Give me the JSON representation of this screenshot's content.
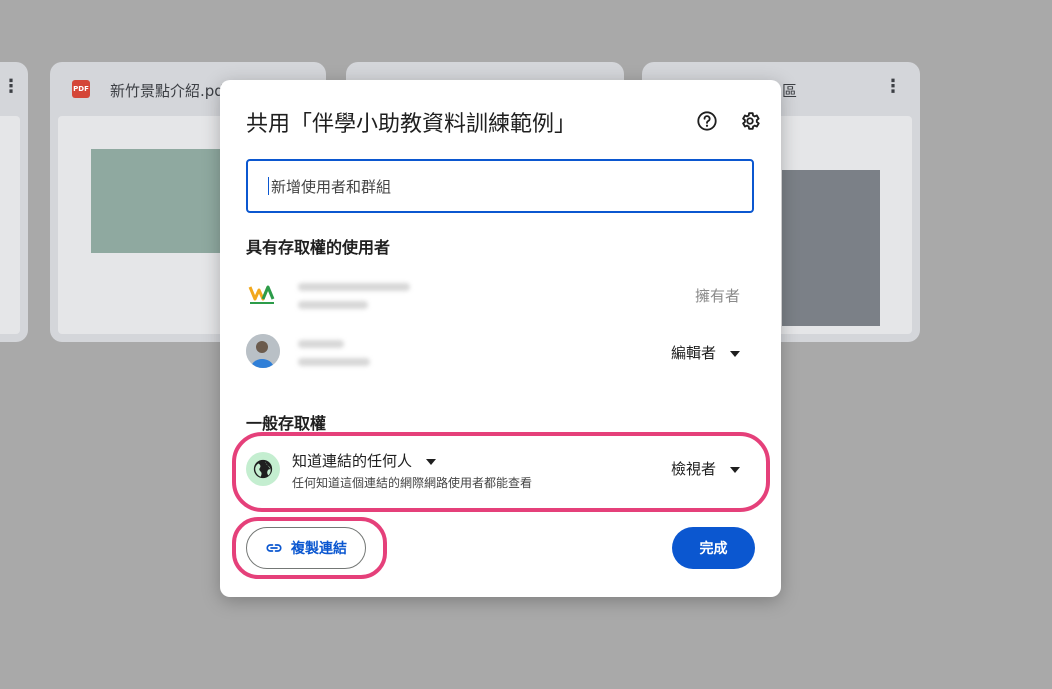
{
  "background": {
    "cards": [
      {
        "title": "",
        "icon": "pdf"
      },
      {
        "title": "新竹景點介紹.pd",
        "icon": "pdf",
        "badge": "PDF"
      },
      {
        "title": "",
        "icon": "none"
      },
      {
        "title": "區",
        "icon": "none"
      }
    ]
  },
  "dialog": {
    "title": "共用「伴學小助教資料訓練範例」",
    "help_icon": "help-circle-icon",
    "settings_icon": "gear-icon",
    "search": {
      "placeholder": "新增使用者和群組"
    },
    "people_section": "具有存取權的使用者",
    "people": [
      {
        "role": "擁有者",
        "avatar": "wesduno-logo"
      },
      {
        "role": "編輯者",
        "avatar": "person-photo"
      }
    ],
    "general_section": "一般存取權",
    "general": {
      "title": "知道連結的任何人",
      "subtitle": "任何知道這個連結的網際網路使用者都能查看",
      "role": "檢視者"
    },
    "copy_link": "複製連結",
    "done": "完成"
  },
  "colors": {
    "accent": "#0b57d0",
    "highlight": "#e5407a",
    "globe_bg": "#c4eed0"
  }
}
